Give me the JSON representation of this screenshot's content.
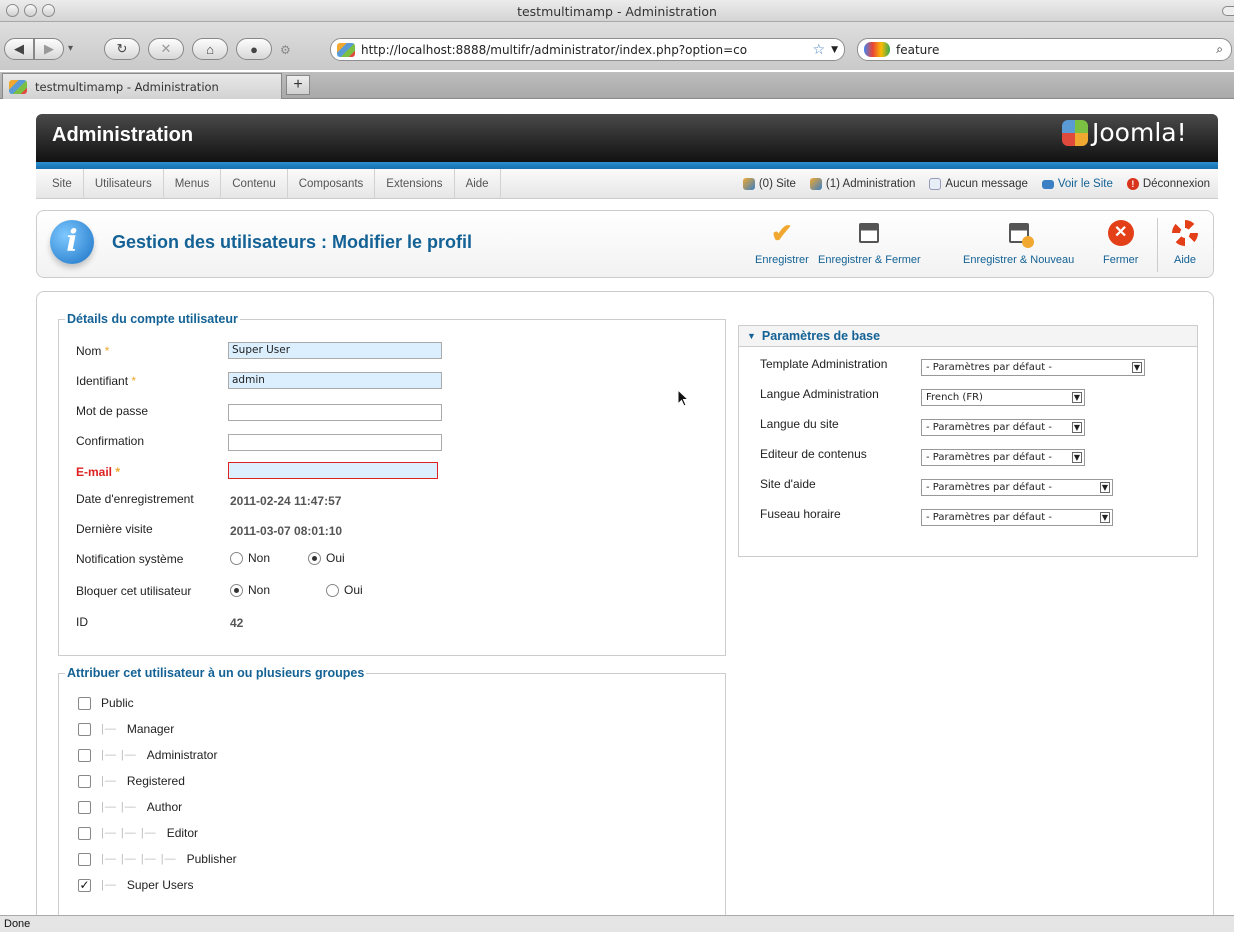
{
  "browser": {
    "window_title": "testmultimamp - Administration",
    "url": "http://localhost:8888/multifr/administrator/index.php?option=co",
    "search_value": "feature",
    "tab_title": "testmultimamp - Administration",
    "new_tab": "+",
    "status": "Done"
  },
  "header": {
    "title": "Administration",
    "brand": "Joomla!"
  },
  "menu": [
    "Site",
    "Utilisateurs",
    "Menus",
    "Contenu",
    "Composants",
    "Extensions",
    "Aide"
  ],
  "status_items": {
    "site": "(0) Site",
    "admin": "(1) Administration",
    "messages": "Aucun message",
    "view_site": "Voir le Site",
    "logout": "Déconnexion"
  },
  "page": {
    "heading": "Gestion des utilisateurs : Modifier le profil"
  },
  "toolbar": {
    "save": "Enregistrer",
    "save_close": "Enregistrer & Fermer",
    "save_new": "Enregistrer & Nouveau",
    "close": "Fermer",
    "help": "Aide"
  },
  "account": {
    "legend": "Détails du compte utilisateur",
    "name_label": "Nom",
    "name_value": "Super User",
    "username_label": "Identifiant",
    "username_value": "admin",
    "password_label": "Mot de passe",
    "password_value": "",
    "confirm_label": "Confirmation",
    "confirm_value": "",
    "email_label": "E-mail",
    "email_value": "",
    "required_mark": "*",
    "register_label": "Date d'enregistrement",
    "register_value": "2011-02-24 11:47:57",
    "lastvisit_label": "Dernière visite",
    "lastvisit_value": "2011-03-07 08:01:10",
    "notif_label": "Notification système",
    "block_label": "Bloquer cet utilisateur",
    "opt_no": "Non",
    "opt_yes": "Oui",
    "notif_selected": "Oui",
    "block_selected": "Non",
    "id_label": "ID",
    "id_value": "42"
  },
  "groups": {
    "legend": "Attribuer cet utilisateur à un ou plusieurs groupes",
    "items": [
      {
        "label": "Public",
        "depth": 0,
        "checked": false
      },
      {
        "label": "Manager",
        "depth": 1,
        "checked": false
      },
      {
        "label": "Administrator",
        "depth": 2,
        "checked": false
      },
      {
        "label": "Registered",
        "depth": 1,
        "checked": false
      },
      {
        "label": "Author",
        "depth": 2,
        "checked": false
      },
      {
        "label": "Editor",
        "depth": 3,
        "checked": false
      },
      {
        "label": "Publisher",
        "depth": 4,
        "checked": false
      },
      {
        "label": "Super Users",
        "depth": 1,
        "checked": true
      }
    ]
  },
  "params": {
    "title": "Paramètres de base",
    "rows": [
      {
        "label": "Template Administration",
        "value": "- Paramètres par défaut -"
      },
      {
        "label": "Langue Administration",
        "value": "French (FR)"
      },
      {
        "label": "Langue du site",
        "value": "- Paramètres par défaut -"
      },
      {
        "label": "Editeur de contenus",
        "value": "- Paramètres par défaut -"
      },
      {
        "label": "Site d'aide",
        "value": "- Paramètres par défaut -"
      },
      {
        "label": "Fuseau horaire",
        "value": "- Paramètres par défaut -"
      }
    ]
  },
  "colors": {
    "accent": "#146295",
    "header_bg": "#111111",
    "blue_bar": "#2a8fd0",
    "required": "#f0a830",
    "error": "#dd2222"
  }
}
